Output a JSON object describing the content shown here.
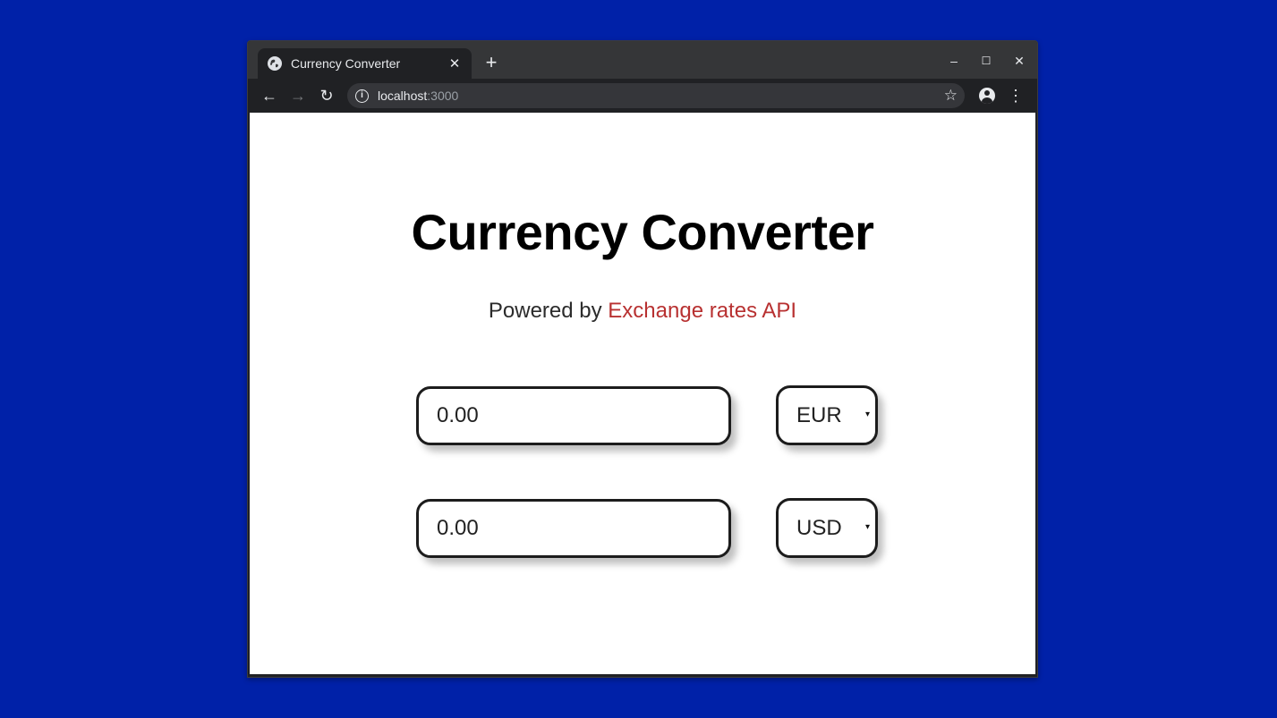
{
  "browser": {
    "tab": {
      "title": "Currency Converter",
      "favicon": "globe-icon",
      "close_glyph": "✕"
    },
    "new_tab_glyph": "+",
    "window_controls": {
      "minimize": "–",
      "maximize": "☐",
      "close": "✕"
    },
    "nav": {
      "back": "←",
      "forward": "→",
      "reload": "↻"
    },
    "address": {
      "host": "localhost",
      "port": ":3000",
      "info_glyph": "i",
      "star_glyph": "☆"
    },
    "menu_glyph": "⋮"
  },
  "page": {
    "heading": "Currency Converter",
    "powered_prefix": "Powered by ",
    "powered_link": "Exchange rates API",
    "link_color": "#b83131",
    "rows": [
      {
        "amount": "0.00",
        "currency": "EUR"
      },
      {
        "amount": "0.00",
        "currency": "USD"
      }
    ],
    "select_arrow": "▾"
  },
  "colors": {
    "desktop_background": "#0021a8",
    "browser_frame": "#202124"
  }
}
